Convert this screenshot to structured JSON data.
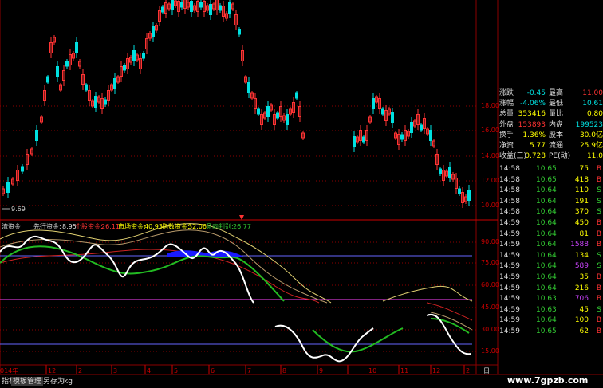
{
  "colors": {
    "up": "#ff3333",
    "down": "#00e0e0",
    "grid": "#8b0000",
    "yellow": "#ffff00",
    "green": "#33cc33",
    "magenta": "#ff44ff"
  },
  "price_axis": [
    "18.00",
    "16.00",
    "14.00",
    "12.00",
    "10.00"
  ],
  "low_marker": "9.69",
  "indicator_axis": [
    "90.00",
    "75.00",
    "60.00",
    "45.00",
    "30.00",
    "15.00"
  ],
  "legend": {
    "item0": "流资金",
    "item1_label": "先行资金:",
    "item1_value": "8.95",
    "item2_label": "个股资金:",
    "item2_value": "26.11",
    "item3_label": "市场资金:",
    "item3_value": "40.93",
    "item4_label": "指数资金:",
    "item4_value": "32.06",
    "item5_label": "意向判别:",
    "item5_value": "26.77"
  },
  "time_axis": [
    "014年",
    "12",
    "2",
    "3",
    "4",
    "5",
    "6",
    "7",
    "8",
    "9",
    "10",
    "11",
    "12",
    "2"
  ],
  "time_axis_right": "日",
  "bottom_tabs": [
    "指标",
    "模板",
    "管理",
    "另存为",
    "kg"
  ],
  "quote": [
    {
      "l1": "涨跌",
      "v1": "-0.45",
      "l2": "最高",
      "v2": "11.00"
    },
    {
      "l1": "涨幅",
      "v1": "-4.06%",
      "l2": "最低",
      "v2": "10.61"
    },
    {
      "l1": "总量",
      "v1": "353416",
      "l2": "量比",
      "v2": "0.80"
    },
    {
      "l1": "外盘",
      "v1": "153893",
      "l2": "内盘",
      "v2": "199523"
    },
    {
      "l1": "换手",
      "v1": "1.36%",
      "l2": "股本",
      "v2": "30.0亿"
    },
    {
      "l1": "净资",
      "v1": "5.77",
      "l2": "流通",
      "v2": "25.9亿"
    },
    {
      "l1": "收益(三)",
      "v1": "0.728",
      "l2": "PE(动)",
      "v2": "11.0"
    }
  ],
  "ticks": [
    {
      "time": "14:58",
      "price": "10.65",
      "vol": "75",
      "side": "B"
    },
    {
      "time": "14:58",
      "price": "10.65",
      "vol": "418",
      "side": "B"
    },
    {
      "time": "14:58",
      "price": "10.64",
      "vol": "110",
      "side": "S"
    },
    {
      "time": "14:58",
      "price": "10.64",
      "vol": "191",
      "side": "S"
    },
    {
      "time": "14:58",
      "price": "10.64",
      "vol": "370",
      "side": "S"
    },
    {
      "time": "14:59",
      "price": "10.64",
      "vol": "450",
      "side": "B"
    },
    {
      "time": "14:59",
      "price": "10.64",
      "vol": "81",
      "side": "B"
    },
    {
      "time": "14:59",
      "price": "10.64",
      "vol": "1588",
      "side": "B"
    },
    {
      "time": "14:59",
      "price": "10.64",
      "vol": "134",
      "side": "S"
    },
    {
      "time": "14:59",
      "price": "10.64",
      "vol": "589",
      "side": "S"
    },
    {
      "time": "14:59",
      "price": "10.64",
      "vol": "35",
      "side": "B"
    },
    {
      "time": "14:59",
      "price": "10.64",
      "vol": "216",
      "side": "B"
    },
    {
      "time": "14:59",
      "price": "10.63",
      "vol": "706",
      "side": "B"
    },
    {
      "time": "14:59",
      "price": "10.63",
      "vol": "45",
      "side": "S"
    },
    {
      "time": "14:59",
      "price": "10.64",
      "vol": "100",
      "side": "B"
    },
    {
      "time": "14:59",
      "price": "10.65",
      "vol": "62",
      "side": "B"
    }
  ],
  "watermark": "www.7gpzb.com"
}
